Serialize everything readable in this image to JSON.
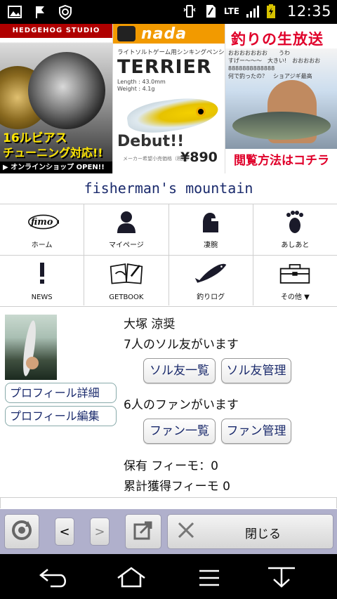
{
  "status_bar": {
    "time": "12:35",
    "network": "LTE",
    "left_icons": [
      "image-icon",
      "flag-icon",
      "shield-icon"
    ],
    "right_icons": [
      "vibrate-icon",
      "sim-icon",
      "signal-icon",
      "battery-icon"
    ]
  },
  "banners": [
    {
      "strip": "HEDGEHOG STUDIO",
      "line1": "16ルビアス",
      "line2": "チューニング対応!!",
      "footer": "▶ オンラインショップ OPEN!!"
    },
    {
      "brand": "nada",
      "subtitle": "ライトソルトゲーム用シンキングペンシル",
      "product": "TERRIER",
      "spec_length": "Length : 43.0mm",
      "spec_weight": "Weight : 4.1g",
      "debut": "Debut!!",
      "note": "メーカー希望小売価格（税抜）",
      "price": "¥890"
    },
    {
      "title": "釣りの生放送",
      "chat_lines": [
        "おおおおおおお　　うわ",
        "すげー～～～　大きい!　おおおおお",
        "8888888888888",
        "何で釣ったの？　ショアジギ最高"
      ],
      "caption": "閲覧方法はコチラ"
    }
  ],
  "site_title": "fisherman's mountain",
  "nav": [
    {
      "label": "ホーム",
      "icon": "fimo-logo-icon"
    },
    {
      "label": "マイページ",
      "icon": "person-icon"
    },
    {
      "label": "凄腕",
      "icon": "arm-icon"
    },
    {
      "label": "あしあと",
      "icon": "footprint-icon"
    },
    {
      "label": "NEWS",
      "icon": "exclamation-icon"
    },
    {
      "label": "GETBOOK",
      "icon": "book-icon"
    },
    {
      "label": "釣りログ",
      "icon": "fish-icon"
    },
    {
      "label": "その他 ▼",
      "icon": "toolbox-icon"
    }
  ],
  "profile": {
    "name": "大塚 涼奨",
    "buddies_text": "7人のソル友がいます",
    "buddy_list_button": "ソル友一覧",
    "buddy_manage_button": "ソル友管理",
    "fans_text": "6人のファンがいます",
    "fan_list_button": "ファン一覧",
    "fan_manage_button": "ファン管理",
    "holding_text": "保有 フィーモ：0",
    "earned_text": "累計獲得フィーモ 0",
    "detail_button": "プロフィール詳細",
    "edit_button": "プロフィール編集"
  },
  "toolbar": {
    "back_label": "<",
    "forward_label": ">",
    "close_label": "閉じる"
  }
}
